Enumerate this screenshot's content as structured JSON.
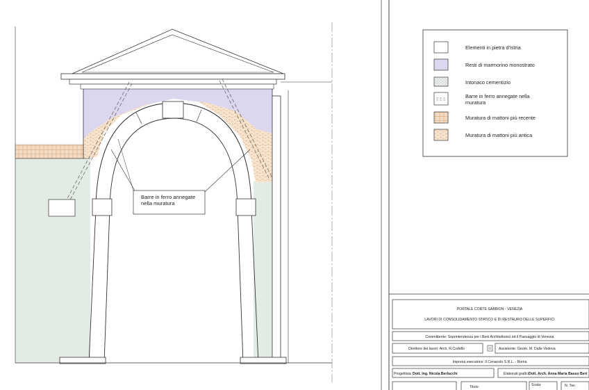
{
  "callout": {
    "line1": "Barre in ferro annegate",
    "line2": "nella muratura"
  },
  "legend": {
    "items": [
      {
        "label": "Elementi in pietra d'Istria",
        "swatch": "plain"
      },
      {
        "label": "Resti di marmorino monostrato",
        "swatch": "lilac"
      },
      {
        "label": "Intonaco cementizio",
        "swatch": "dots"
      },
      {
        "label": "Barre in ferro annegate nella",
        "label2": "muratura",
        "swatch": "bars"
      },
      {
        "label": "Muratura di mattoni più recente",
        "swatch": "brick"
      },
      {
        "label": "Muratura di mattoni più antica",
        "swatch": "old"
      }
    ]
  },
  "title_block": {
    "project": "PORTALE CORTE SABBION - VENEZIA",
    "works": "LAVORI DI CONSOLIDAMENTO STATICO E DI RESTAURO DELLE SUPERFICI",
    "client": "Committente: Soprintendenza per i Beni Architettonici ed il Paesaggio di Venezia",
    "director": "Direttore dei lavori: Arch. R.Codello",
    "assistant": "Assistente: Geom. M. Dalle Vedova",
    "contractor": "Impresa esecutrice: Il Cenacolo S.R.L. - Roma",
    "designer_label": "Progettista",
    "designer": "Dott. Ing. Nicola Berlucchi",
    "graphics_label": "Elaborati grafici",
    "graphics": "Dott. Arch. Anna Maria Basso Bert",
    "title_label": "Titolo:",
    "scale_label": "Scala:",
    "sheet_label": "N. Tav."
  },
  "colors": {
    "lilac": "#dcd6ee",
    "green_wall": "#e3ebe5",
    "brick": "#f4dcc4",
    "old_brick": "#f7e2cc",
    "line": "#333333"
  }
}
